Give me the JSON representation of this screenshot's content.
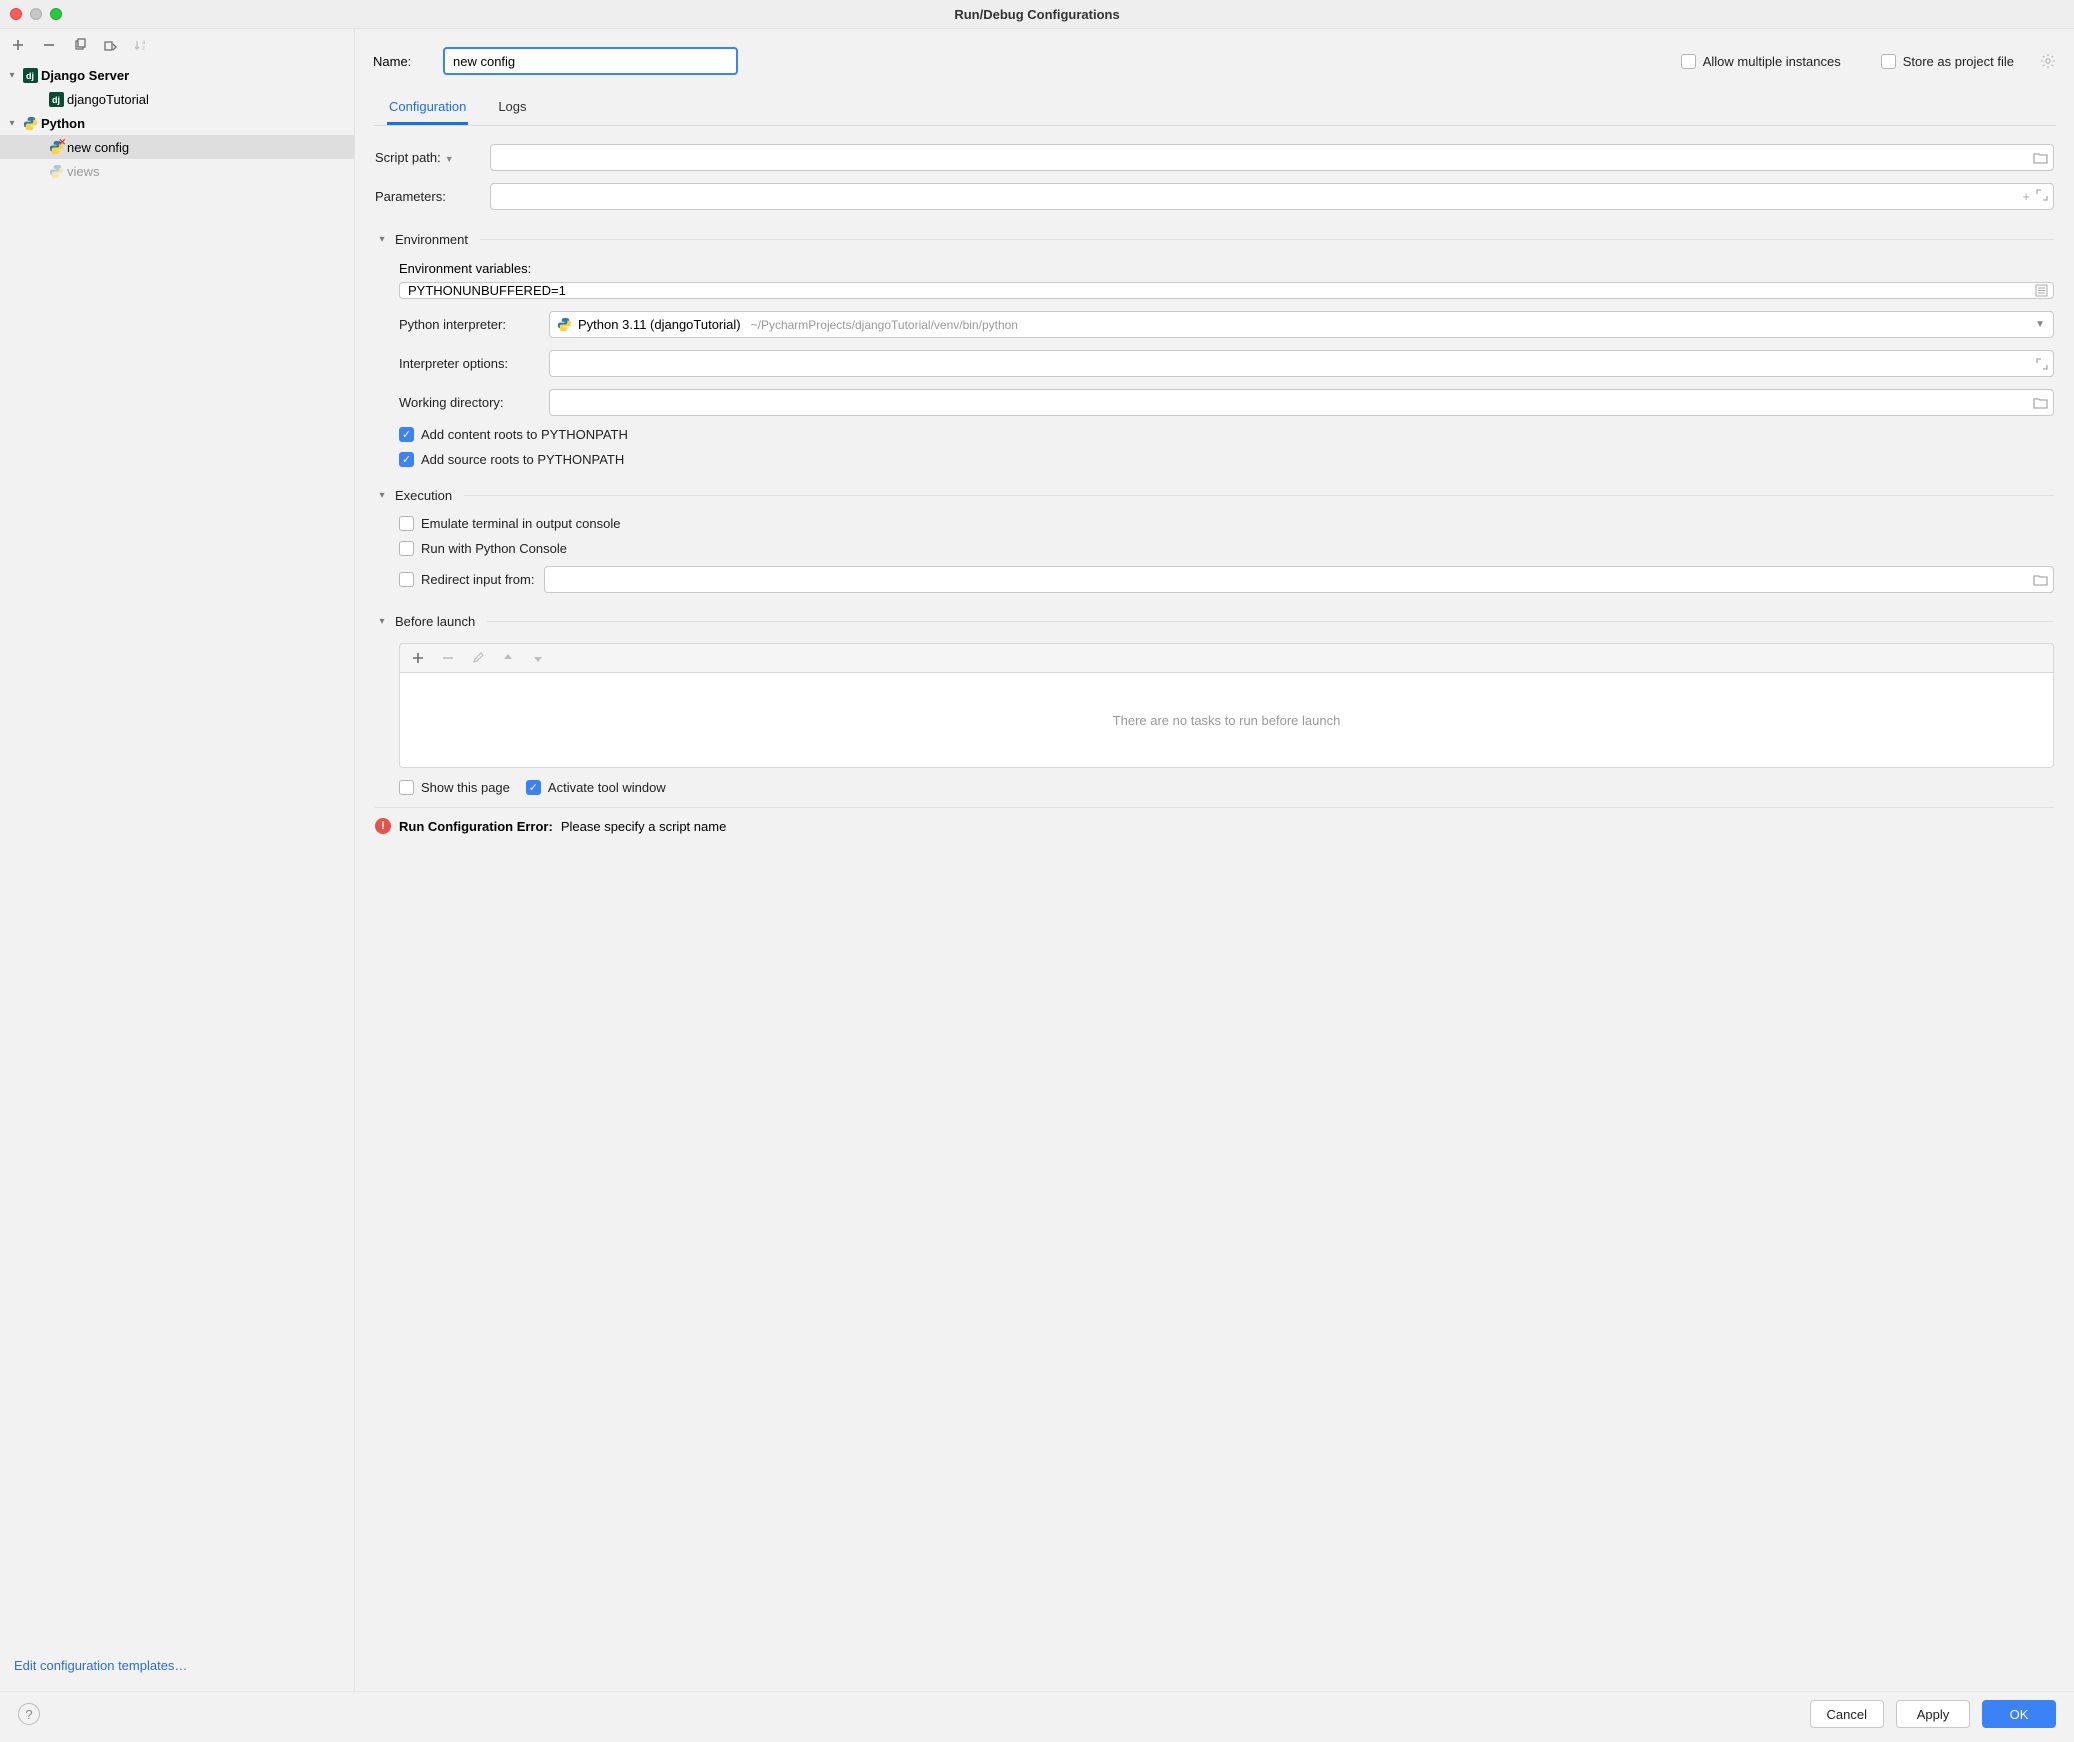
{
  "window": {
    "title": "Run/Debug Configurations"
  },
  "sidebar": {
    "edit_templates": "Edit configuration templates…",
    "groups": [
      {
        "name": "Django Server",
        "icon": "django-icon",
        "children": [
          {
            "name": "djangoTutorial",
            "icon": "django-icon",
            "selected": false,
            "dimmed": false
          }
        ]
      },
      {
        "name": "Python",
        "icon": "python-icon",
        "children": [
          {
            "name": "new config",
            "icon": "python-icon",
            "selected": true,
            "dimmed": false,
            "badge": "error"
          },
          {
            "name": "views",
            "icon": "python-icon",
            "selected": false,
            "dimmed": true
          }
        ]
      }
    ]
  },
  "header": {
    "name_label": "Name:",
    "name_value": "new config",
    "allow_multiple": "Allow multiple instances",
    "store_project": "Store as project file"
  },
  "tabs": {
    "config": "Configuration",
    "logs": "Logs",
    "active": "config"
  },
  "fields": {
    "script_path_label": "Script path:",
    "script_path_value": "",
    "parameters_label": "Parameters:",
    "parameters_value": ""
  },
  "env": {
    "section": "Environment",
    "vars_label": "Environment variables:",
    "vars_value": "PYTHONUNBUFFERED=1",
    "interp_label": "Python interpreter:",
    "interp_name": "Python 3.11 (djangoTutorial)",
    "interp_path": "~/PycharmProjects/djangoTutorial/venv/bin/python",
    "interp_opts_label": "Interpreter options:",
    "interp_opts_value": "",
    "workdir_label": "Working directory:",
    "workdir_value": "",
    "content_roots": "Add content roots to PYTHONPATH",
    "source_roots": "Add source roots to PYTHONPATH"
  },
  "exec": {
    "section": "Execution",
    "emulate": "Emulate terminal in output console",
    "run_console": "Run with Python Console",
    "redirect": "Redirect input from:",
    "redirect_value": ""
  },
  "before": {
    "section": "Before launch",
    "empty": "There are no tasks to run before launch",
    "show_page": "Show this page",
    "activate_tool": "Activate tool window"
  },
  "error": {
    "label": "Run Configuration Error:",
    "msg": "Please specify a script name"
  },
  "buttons": {
    "cancel": "Cancel",
    "apply": "Apply",
    "ok": "OK"
  }
}
